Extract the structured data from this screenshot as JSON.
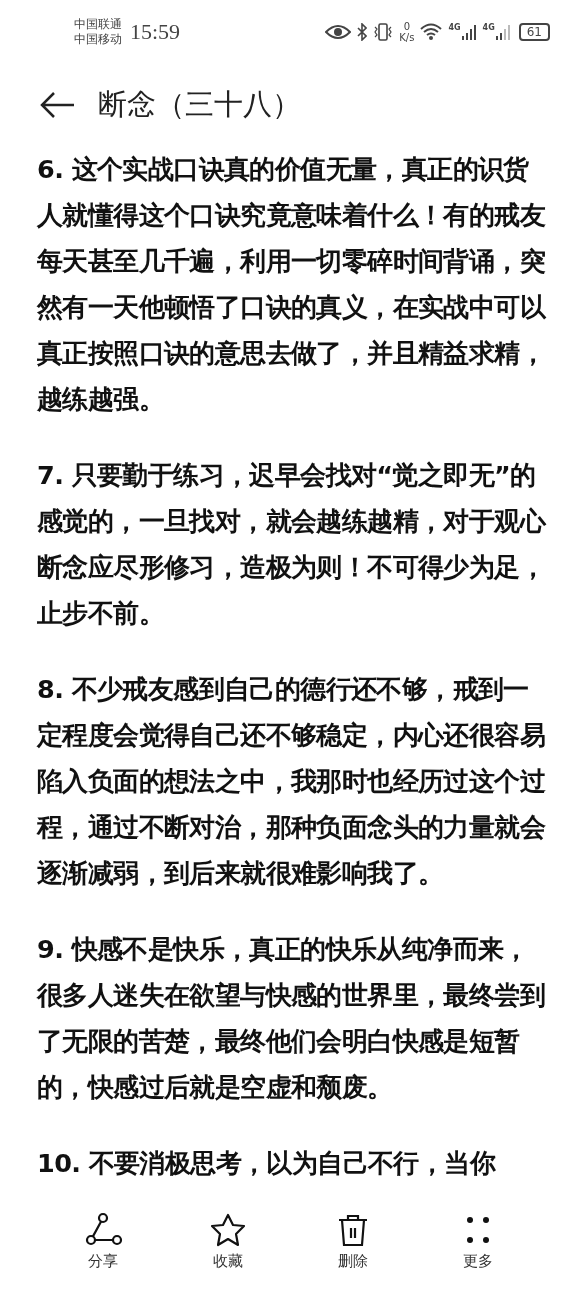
{
  "status_bar": {
    "carriers": [
      "中国联通",
      "中国移动"
    ],
    "time": "15:59",
    "net_speed_value": "0",
    "net_speed_unit": "K/s",
    "network_labels": [
      "4G",
      "4G"
    ],
    "battery": "61"
  },
  "header": {
    "title": "断念（三十八）"
  },
  "paragraphs": [
    "6. 这个实战口诀真的价值无量，真正的识货人就懂得这个口诀究竟意味着什么！有的戒友每天甚至几千遍，利用一切零碎时间背诵，突然有一天他顿悟了口诀的真义，在实战中可以真正按照口诀的意思去做了，并且精益求精，越练越强。",
    "7. 只要勤于练习，迟早会找对“觉之即无”的感觉的，一旦找对，就会越练越精，对于观心断念应尽形修习，造极为则！不可得少为足，止步不前。",
    "8. 不少戒友感到自己的德行还不够，戒到一定程度会觉得自己还不够稳定，内心还很容易陷入负面的想法之中，我那时也经历过这个过程，通过不断对治，那种负面念头的力量就会逐渐减弱，到后来就很难影响我了。",
    "9. 快感不是快乐，真正的快乐从纯净而来，很多人迷失在欲望与快感的世界里，最终尝到了无限的苦楚，最终他们会明白快感是短暂的，快感过后就是空虚和颓废。",
    "10. 不要消极思考，以为自己不行，当你"
  ],
  "toolbar": [
    {
      "kind": "share",
      "label": "分享"
    },
    {
      "kind": "star",
      "label": "收藏"
    },
    {
      "kind": "delete",
      "label": "删除"
    },
    {
      "kind": "more",
      "label": "更多"
    }
  ]
}
